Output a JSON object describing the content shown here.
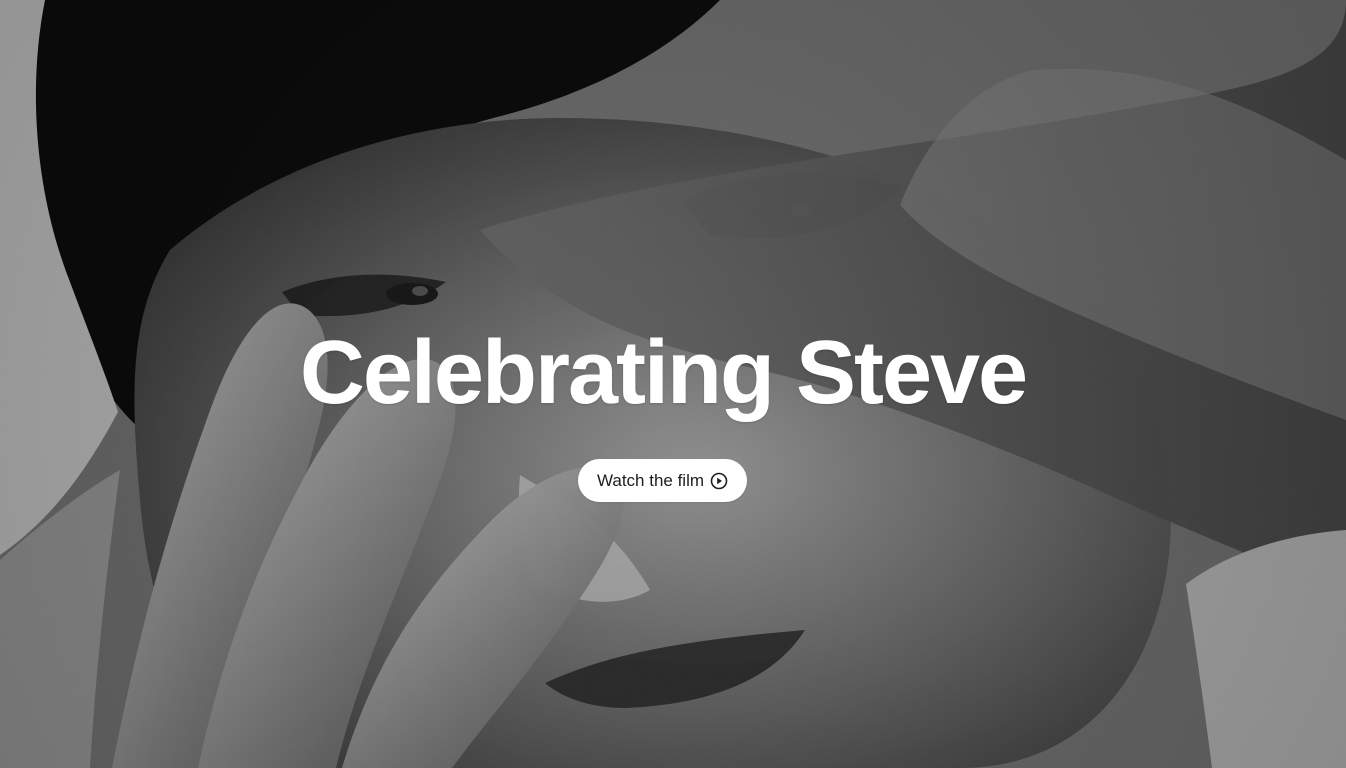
{
  "hero": {
    "title": "Celebrating Steve",
    "cta_label": "Watch the film",
    "icon": "play-circle-icon",
    "photo_subject": "black-and-white portrait with hand raised near face"
  },
  "colors": {
    "title_text": "#ffffff",
    "button_background": "#ffffff",
    "button_text": "#1d1d1f"
  }
}
